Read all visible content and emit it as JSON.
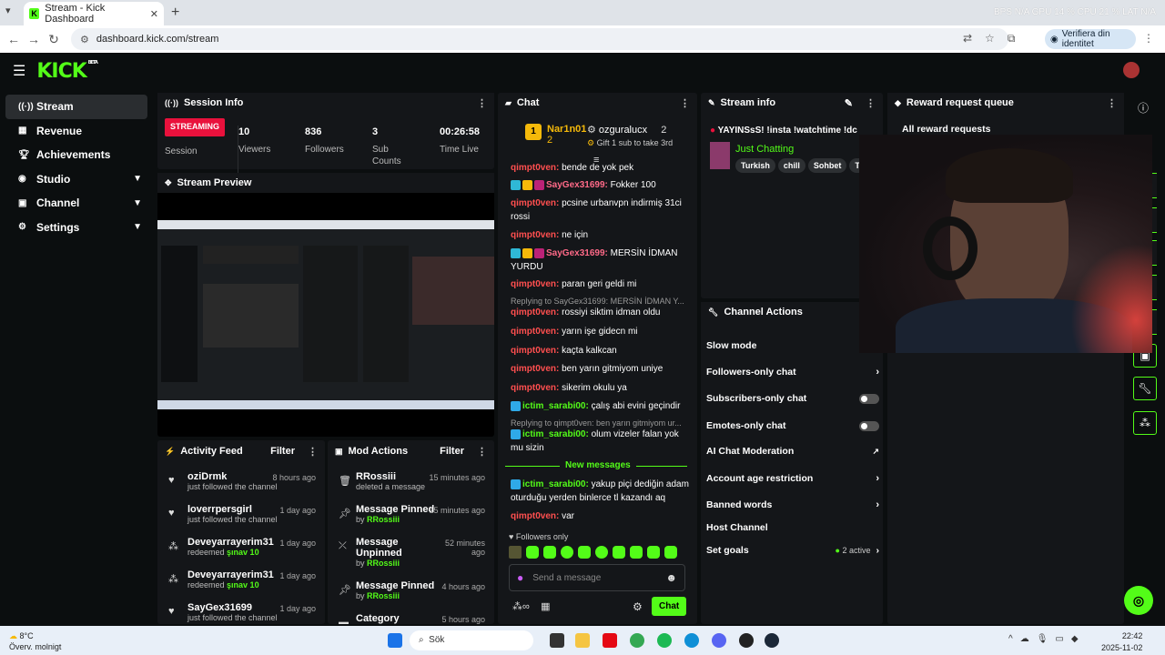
{
  "browser": {
    "tab_title": "Stream - Kick Dashboard",
    "url": "dashboard.kick.com/stream",
    "profile_label": "Verifiera din identitet",
    "stats": "BPS N/A   GPU 14 %   CPU 21 %   LAT N/A"
  },
  "header": {
    "logo": "KICK",
    "beta": "BETA"
  },
  "sidebar": {
    "items": [
      {
        "label": "Stream"
      },
      {
        "label": "Revenue"
      },
      {
        "label": "Achievements"
      },
      {
        "label": "Studio"
      },
      {
        "label": "Channel"
      },
      {
        "label": "Settings"
      }
    ]
  },
  "session": {
    "title": "Session Info",
    "badge": "STREAMING",
    "session_label": "Session",
    "viewers": "10",
    "viewers_label": "Viewers",
    "followers": "836",
    "followers_label": "Followers",
    "subs": "3",
    "subs_label": "Sub Counts",
    "time": "00:26:58",
    "time_label": "Time Live"
  },
  "preview": {
    "title": "Stream Preview"
  },
  "activity": {
    "title": "Activity Feed",
    "filter": "Filter",
    "items": [
      {
        "name": "oziDrmk",
        "sub": "just followed the channel",
        "time": "8 hours ago"
      },
      {
        "name": "loverrpersgirl",
        "sub": "just followed the channel",
        "time": "1 day ago"
      },
      {
        "name": "Deveyarrayerim31",
        "sub": "redeemed",
        "reward": "şınav 10",
        "time": "1 day ago"
      },
      {
        "name": "Deveyarrayerim31",
        "sub": "redeemed",
        "reward": "şınav 10",
        "time": "1 day ago"
      },
      {
        "name": "SayGex31699",
        "sub": "just followed the channel",
        "time": "1 day ago"
      }
    ]
  },
  "mod": {
    "title": "Mod Actions",
    "filter": "Filter",
    "by": "by",
    "items": [
      {
        "action": "RRossiii",
        "sub": "deleted a message",
        "time": "15 minutes ago"
      },
      {
        "action": "Message Pinned",
        "user": "RRossiii",
        "time": "15 minutes ago"
      },
      {
        "action": "Message Unpinned",
        "user": "RRossiii",
        "time": "52 minutes ago"
      },
      {
        "action": "Message Pinned",
        "user": "RRossiii",
        "time": "4 hours ago"
      },
      {
        "action": "Category",
        "time": "5 hours ago"
      }
    ]
  },
  "chat": {
    "title": "Chat",
    "top1": "Nar1n01",
    "top1_count": "2",
    "top2": "ozguraluсx",
    "top2_count": "2",
    "gift": "Gift 1 sub to take 3rd",
    "lines": [
      {
        "user": "qimpt0ven:",
        "text": "bende de yok pek"
      },
      {
        "user": "SayGex31699:",
        "text": "Fokker 100"
      },
      {
        "user": "qimpt0ven:",
        "text": "pcsine urbanvpn indirmiş 31ci rossi"
      },
      {
        "user": "qimpt0ven:",
        "text": "ne için"
      },
      {
        "user": "SayGex31699:",
        "text": "MERSİN İDMAN YURDU"
      },
      {
        "user": "qimpt0ven:",
        "text": "paran geri geldi mi"
      },
      {
        "reply": "Replying to SayGex31699: MERSİN İDMAN Y..."
      },
      {
        "user": "qimpt0ven:",
        "text": "rossiyi siktim idman oldu"
      },
      {
        "user": "qimpt0ven:",
        "text": "yarın işe gidecn mi"
      },
      {
        "user": "qimpt0ven:",
        "text": "kaçta kalkcan"
      },
      {
        "user": "qimpt0ven:",
        "text": "ben yarın gitmiyom uniye"
      },
      {
        "user": "qimpt0ven:",
        "text": "sikerim okulu ya"
      },
      {
        "user": "ictim_sarabi00:",
        "text": "çalış abi evini geçindir"
      },
      {
        "reply": "Replying to qimpt0ven: ben yarın gitmiyom ur..."
      },
      {
        "user": "ictim_sarabi00:",
        "text": "olum vizeler falan yok mu sizin"
      },
      {
        "user": "ictim_sarabi00:",
        "text": "yakup piçi dediğin adam oturduğu yerden binlerce tl kazandı aq"
      },
      {
        "user": "qimpt0ven:",
        "text": "var"
      }
    ],
    "new_messages": "New messages",
    "followers_only": "Followers only",
    "placeholder": "Send a message",
    "send": "Chat"
  },
  "stream_info": {
    "title": "Stream info",
    "stream_title": "YAYINSsS! !insta !watchtime !dc",
    "category": "Just Chatting",
    "tags": [
      "Turkish",
      "chill",
      "Sohbet",
      "Tür"
    ]
  },
  "channel_actions": {
    "title": "Channel Actions",
    "items": [
      {
        "label": "Slow mode"
      },
      {
        "label": "Followers-only chat"
      },
      {
        "label": "Subscribers-only chat"
      },
      {
        "label": "Emotes-only chat"
      },
      {
        "label": "AI Chat Moderation"
      },
      {
        "label": "Account age restriction"
      },
      {
        "label": "Banned words"
      },
      {
        "label": "Host Channel"
      },
      {
        "label": "Set goals",
        "status": "2 active"
      }
    ]
  },
  "reward": {
    "title": "Reward request queue",
    "all": "All reward requests"
  },
  "taskbar": {
    "temp": "8°C",
    "weather": "Överv. molnigt",
    "search": "Sök",
    "time": "22:42",
    "date": "2025-11-02"
  },
  "colors": {
    "accent": "#53fc18",
    "live": "#e9113c"
  }
}
